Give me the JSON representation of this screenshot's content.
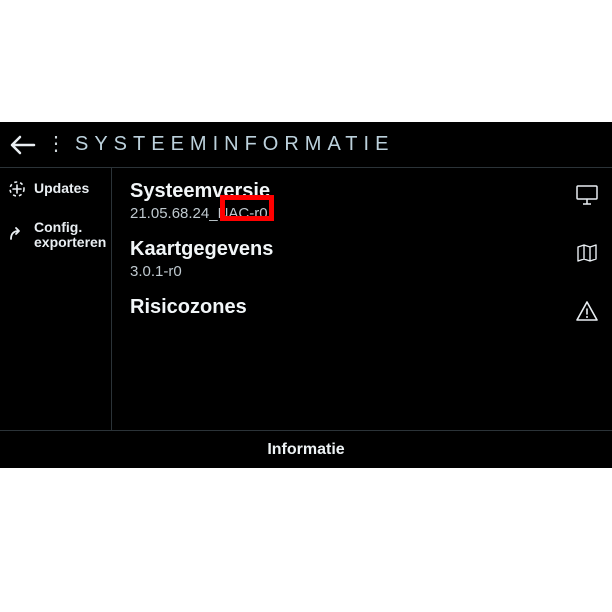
{
  "header": {
    "title": "SYSTEEMINFORMATIE"
  },
  "sidebar": {
    "items": [
      {
        "label": "Updates"
      },
      {
        "label": "Config.\nexporteren"
      }
    ]
  },
  "main": {
    "rows": [
      {
        "title": "Systeemversie",
        "value": "21.05.68.24_NAC-r0"
      },
      {
        "title": "Kaartgegevens",
        "value": "3.0.1-r0"
      },
      {
        "title": "Risicozones",
        "value": ""
      }
    ]
  },
  "footer": {
    "label": "Informatie"
  }
}
